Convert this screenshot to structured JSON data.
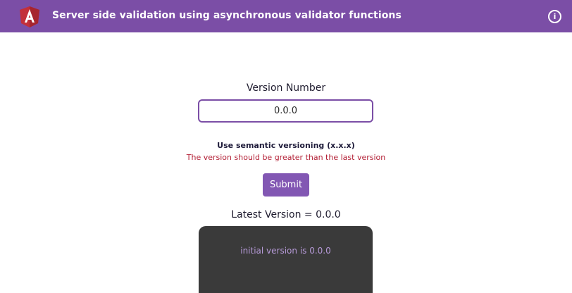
{
  "app_bar": {
    "title": "Server side validation using asynchronous validator functions",
    "logo_icon": "angular-logo-icon",
    "info_icon": "info-icon",
    "info_glyph": "i",
    "color": "#7b4ea6"
  },
  "form": {
    "label": "Version Number",
    "input_value": "0.0.0",
    "hint": "Use semantic versioning (x.x.x)",
    "error": "The version should be greater than the last version",
    "submit_label": "Submit"
  },
  "latest": {
    "text": "Latest Version = 0.0.0"
  },
  "console": {
    "message": "initial version is 0.0.0"
  },
  "colors": {
    "accent": "#7b4ea6",
    "error": "#b32036",
    "console_bg": "#3a3a3a",
    "console_text": "#b69ad8"
  }
}
